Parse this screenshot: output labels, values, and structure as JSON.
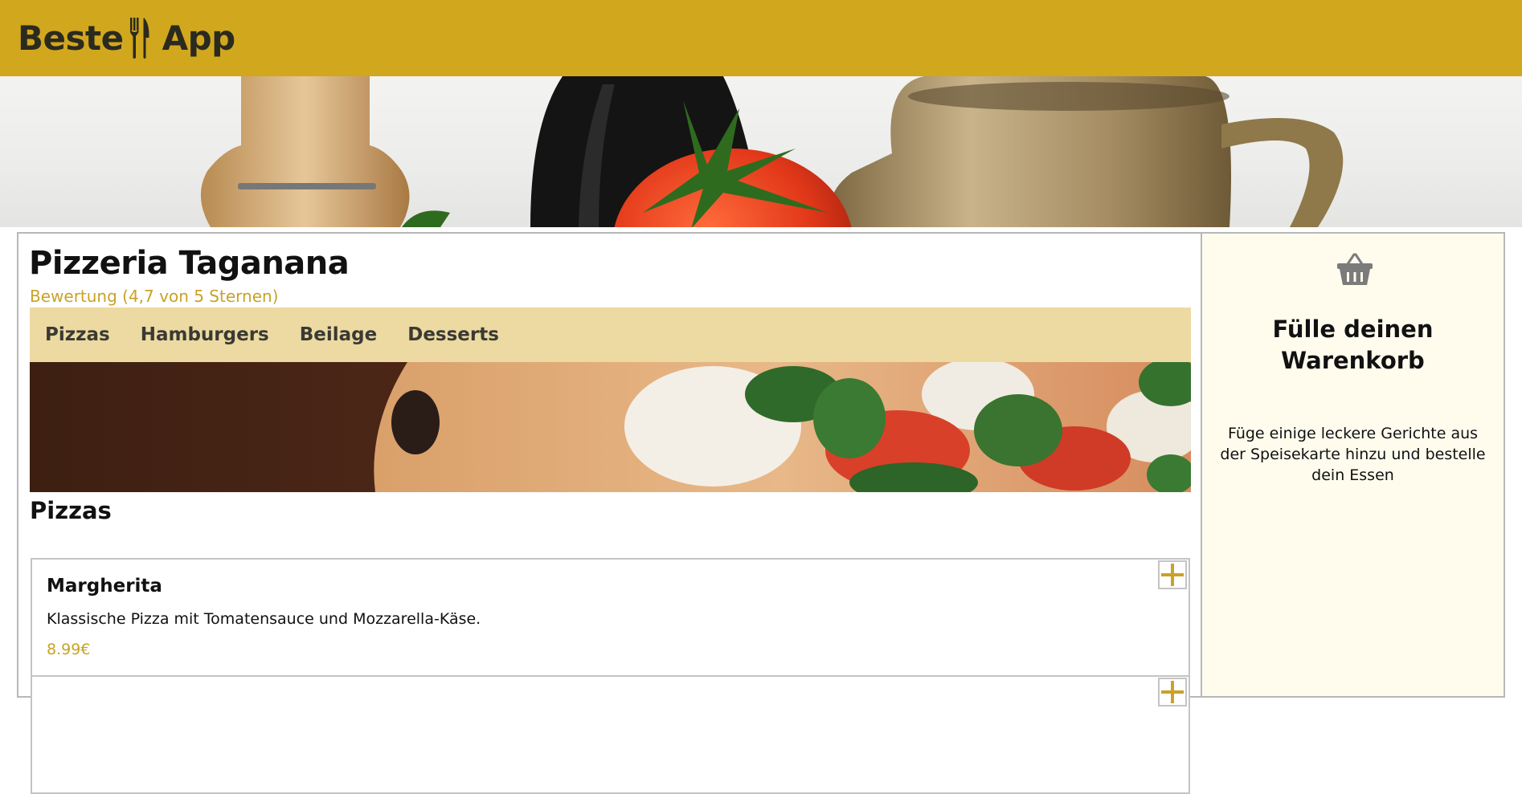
{
  "header": {
    "logo_left": "Beste",
    "logo_right": "App",
    "brand_color": "#d1a71e"
  },
  "restaurant": {
    "name": "Pizzeria Taganana",
    "rating": "Bewertung (4,7 von 5 Sternen)"
  },
  "categories": [
    "Pizzas",
    "Hamburgers",
    "Beilage",
    "Desserts"
  ],
  "section": {
    "title": "Pizzas"
  },
  "items": [
    {
      "name": "Margherita",
      "description": "Klassische Pizza mit Tomatensauce und Mozzarella-Käse.",
      "price": "8.99€"
    }
  ],
  "basket": {
    "title": "Fülle deinen Warenkorb",
    "text": "Füge einige leckere Gerichte aus der Speisekarte hinzu und bestelle dein Essen"
  },
  "icons": {
    "logo": "cutlery-icon",
    "basket": "basket-icon",
    "add": "plus-icon"
  },
  "colors": {
    "accent": "#c9a227",
    "nav_bg": "#ecdaa2",
    "basket_bg": "#fffcee"
  }
}
